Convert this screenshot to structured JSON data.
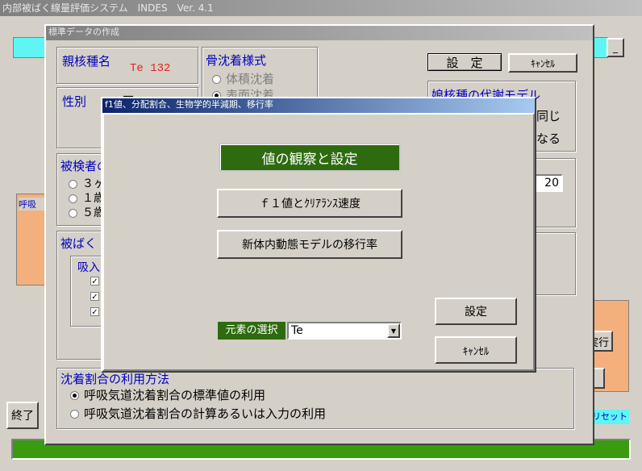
{
  "main_window": {
    "title": "内部被ばく線量評価システム　INDES　Ver. 4.1",
    "end_button": "終了",
    "reset_button": "リセット",
    "exec_button_partial": "実行",
    "minimize_label": "_"
  },
  "std_window": {
    "title": "標準データの作成",
    "parent_nuclide_label": "親核種名",
    "parent_nuclide_value": "Te 132",
    "bone_deposition_label": "骨沈着様式",
    "bone_volume": "体積沈着",
    "bone_surface": "表面沈着",
    "set_button": "設　定",
    "cancel_button": "ｷｬﾝｾﾙ",
    "sex_label": "性別",
    "sex_option_partial": "不一",
    "daughter_model_label": "娘核種の代謝モデル",
    "daughter_same": "同じ",
    "daughter_diff": "なる",
    "subject_label": "被検者の",
    "age_options": [
      "３ヶ",
      "１歳",
      "５歳"
    ],
    "age_value": "20",
    "exposure_label": "被ばく",
    "inhalation_label": "吸入",
    "deposition_title": "沈着割合の利用方法",
    "deposition_standard": "呼吸気道沈着割合の標準値の利用",
    "deposition_calc": "呼吸気道沈着割合の計算あるいは入力の利用",
    "resp_label_partial": "呼吸"
  },
  "dialog": {
    "title": "f1値、分配割合、生物学的半減期、移行率",
    "observe_button": "値の観察と設定",
    "f1_button": "ｆ１値とｸﾘｱﾗﾝｽ速度",
    "transfer_button": "新体内動態モデルの移行率",
    "element_label": "元素の選択",
    "element_value": "Te",
    "set_button": "設定",
    "cancel_button": "ｷｬﾝｾﾙ"
  },
  "colors": {
    "window_bg": "#d4d0c8",
    "dark_green": "#2e6b10",
    "bright_green": "#3a9a10",
    "cyan": "#5ff5f5",
    "orange": "#f4b07c",
    "label_blue": "#0000c0",
    "nuclide_red": "#e02020"
  }
}
